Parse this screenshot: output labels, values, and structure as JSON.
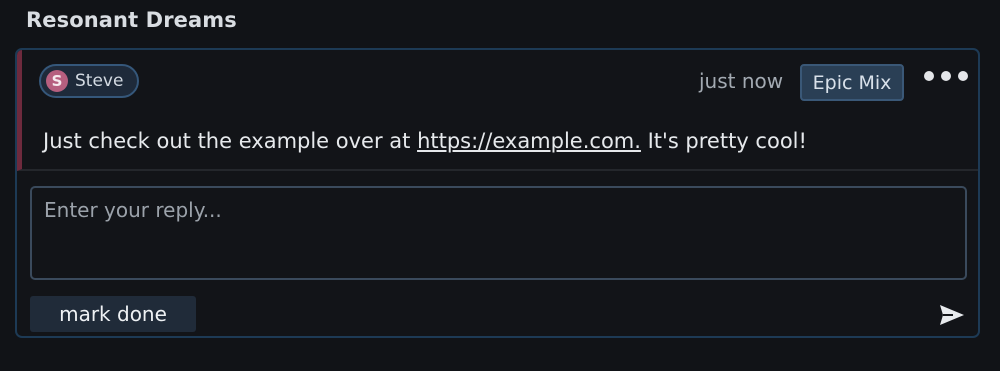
{
  "thread": {
    "title": "Resonant Dreams"
  },
  "comment": {
    "author": {
      "name": "Steve",
      "initial": "S",
      "avatar_color": "#b65f7f"
    },
    "timestamp": "just now",
    "tag": "Epic Mix",
    "body_prefix": "Just check out the example over at ",
    "link_text": "https://example.com.",
    "body_suffix": " It's pretty cool!",
    "accent_color": "#6e2a3d"
  },
  "reply": {
    "placeholder": "Enter your reply...",
    "value": "",
    "mark_done_label": "mark done"
  },
  "icons": {
    "more": "more-horizontal-icon",
    "send": "send-icon"
  }
}
